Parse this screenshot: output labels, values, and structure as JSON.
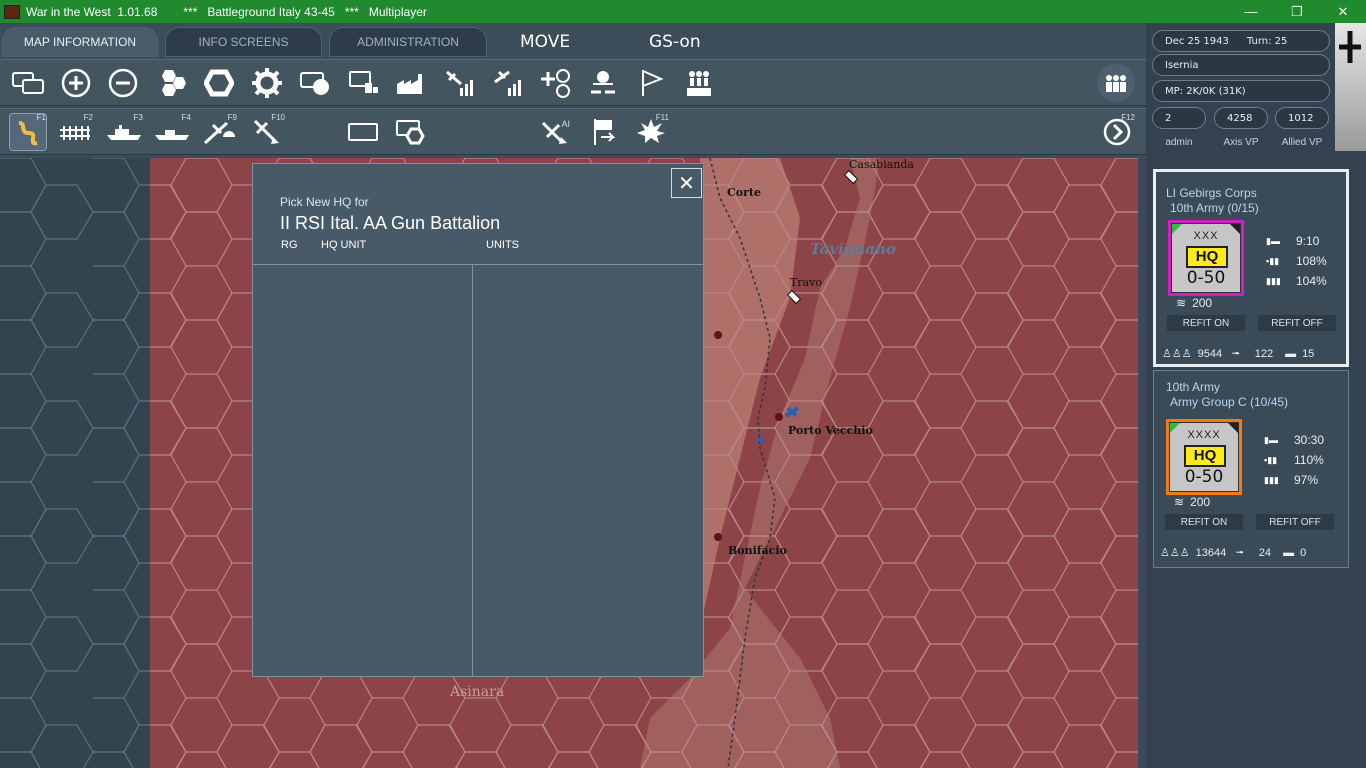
{
  "window": {
    "app_title": "War in the West  1.01.68",
    "scenario_title": "***   Battleground Italy 43-45   ***   Multiplayer"
  },
  "tabs": [
    {
      "label": "MAP INFORMATION"
    },
    {
      "label": "INFO SCREENS"
    },
    {
      "label": "ADMINISTRATION"
    }
  ],
  "modes": {
    "move": "MOVE",
    "gs": "GS-on"
  },
  "toolbar_top": {
    "icons": [
      "stack-windows-icon",
      "zoom-in-icon",
      "zoom-out-icon",
      "hex-grid-icon",
      "hex-outline-icon",
      "settings-gear-icon",
      "unit-counter-icon",
      "supply-icon",
      "industry-icon",
      "air-recon-icon",
      "air-mission-icon",
      "air-targets-icon",
      "weather-icon",
      "victory-flag-icon",
      "reserves-icon",
      "manpower-icon"
    ]
  },
  "toolbar_bottom": {
    "items": [
      {
        "icon": "move-path-icon",
        "fkey": "F1"
      },
      {
        "icon": "rail-icon",
        "fkey": "F2"
      },
      {
        "icon": "naval-transport-icon",
        "fkey": "F3"
      },
      {
        "icon": "naval-invasion-icon",
        "fkey": "F4"
      },
      {
        "icon": "airborne-drop-icon",
        "fkey": "F9"
      },
      {
        "icon": "air-transport-icon",
        "fkey": "F10"
      },
      {
        "icon": "select-box-icon",
        "fkey": ""
      },
      {
        "icon": "unit-focus-icon",
        "fkey": ""
      },
      {
        "icon": "ai-air-icon",
        "fkey": "AI"
      },
      {
        "icon": "retreat-flag-icon",
        "fkey": ""
      },
      {
        "icon": "combat-explosion-icon",
        "fkey": "F11"
      },
      {
        "icon": "end-turn-icon",
        "fkey": "F12"
      }
    ]
  },
  "status": {
    "date": "Dec 25 1943",
    "turn": "Turn: 25",
    "location": "Isernia",
    "mp": "MP: 2K/0K (31K)",
    "admin_value": "2",
    "admin_label": "admin",
    "axis_vp": "4258",
    "axis_vp_label": "Axis VP",
    "allied_vp": "1012",
    "allied_vp_label": "Allied VP"
  },
  "dialog": {
    "subtitle": "Pick New HQ for",
    "title": "II RSI Ital. AA Gun Battalion",
    "col_rg": "RG",
    "col_hq": "HQ UNIT",
    "col_units": "UNITS"
  },
  "hq_cards": [
    {
      "name": "LI Gebirgs Corps",
      "parent": "10th Army (0/15)",
      "size": "XXX",
      "hq": "HQ",
      "strength": "0-50",
      "stat1": "9:10",
      "stat2": "108%",
      "stat3": "104%",
      "mp": "200",
      "refit_on": "REFIT ON",
      "refit_off": "REFIT OFF",
      "men": "9544",
      "guns": "122",
      "afv": "15",
      "border_color": "#d11fc4"
    },
    {
      "name": "10th Army",
      "parent": "Army Group C  (10/45)",
      "size": "XXXX",
      "hq": "HQ",
      "strength": "0-50",
      "stat1": "30:30",
      "stat2": "110%",
      "stat3": "97%",
      "mp": "200",
      "refit_on": "REFIT ON",
      "refit_off": "REFIT OFF",
      "men": "13644",
      "guns": "24",
      "afv": "0",
      "border_color": "#f07a14"
    }
  ],
  "map_labels": {
    "casabianda": "Casabianda",
    "corte": "Corte",
    "tavignano": "Tavignano",
    "travo": "Travo",
    "porto_vecchio": "Porto Vecchio",
    "bonifacio": "Bonifacio",
    "asinara": "Asinara"
  },
  "colors": {
    "enemy_hex": "#8c4446",
    "sea_hex": "#34444e",
    "land": "#9d5a5a"
  }
}
